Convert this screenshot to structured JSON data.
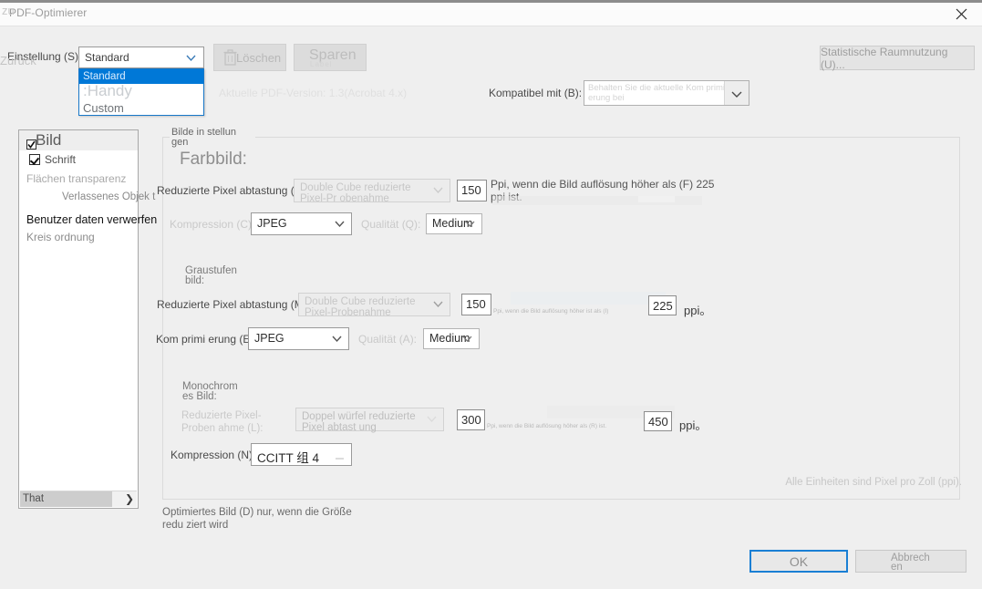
{
  "window": {
    "title": "PDF-Optimierer",
    "close_icon": "close-icon"
  },
  "toolbar": {
    "setting_label": "Einstellung (S):",
    "setting_value": "Standard",
    "setting_options": [
      "Standard",
      ":Handy",
      "Custom"
    ],
    "delete_label": "Löschen",
    "delete_icon": "trash-icon",
    "save_label": "Sparen",
    "save_sub_label": "Label",
    "stats_label": "Statistische Raumnutzung (U)...",
    "pdf_version": "Aktuelle PDF-Version: 1.3(Acrobat 4.x)",
    "compat_label": "Kompatibel mit (B):",
    "compat_value": "Behalten Sie die aktuelle Kom primi erung bei"
  },
  "sidebar": {
    "ghost_top": "zu",
    "ghost_mid": "Zurück",
    "items": [
      {
        "label": "Bild",
        "checkbox": true,
        "state": "selected"
      },
      {
        "label": "Schrift",
        "checkbox": true,
        "state": "checked"
      },
      {
        "label": "Flächen transparenz",
        "checkbox": false,
        "state": "normal"
      },
      {
        "label": "Verlassenes Objek t",
        "checkbox": false,
        "state": "normal"
      },
      {
        "label": "Benutzer daten verwerfen",
        "checkbox": false,
        "state": "bold"
      },
      {
        "label": "Kreis ordnung",
        "checkbox": false,
        "state": "normal"
      }
    ],
    "scroll_label": "That",
    "scroll_arrow": "chevron-right-icon"
  },
  "main": {
    "group_title": "Bilde in stellun gen",
    "color_image": {
      "section_title": "Farbbild:",
      "downsample_label": "Reduzierte Pixel abtastung (P):",
      "downsample_value": "Double Cube reduzierte Pixel-Pr obenahme",
      "ppi_value": "150",
      "ppi_note": "Ppi, wenn die Bild auflösung höher als (F) 225 ppi ist.",
      "compression_label": "Kompression (C):",
      "compression_value": "JPEG",
      "quality_label": "Qualität (Q):",
      "quality_value": "Medium"
    },
    "gray_image": {
      "section_title": "Graustufen bild:",
      "downsample_label": "Reduzierte Pixel abtastung (M):",
      "downsample_value": "Double Cube reduzierte Pixel-Probenahme",
      "ppi_value": "150",
      "ppi_note": "Ppi, wenn die Bild auflösung höher ist als (I)",
      "threshold_value": "225",
      "threshold_unit": "ppi。",
      "compression_label": "Kom primi erung (E):",
      "compression_value": "JPEG",
      "quality_label": "Qualität (A):",
      "quality_value": "Medium"
    },
    "mono_image": {
      "section_title": "Monochrom es Bild:",
      "downsample_label": "Reduzierte Pixel-Proben ahme (L):",
      "downsample_value": "Doppel würfel reduzierte Pixel abtast ung",
      "ppi_value": "300",
      "ppi_note": "Ppi, wenn die Bild auflösung höher als (R) ist.",
      "threshold_value": "450",
      "threshold_unit": "ppi。",
      "compression_label": "Kompression (N):",
      "compression_value": "CCITT 组 4"
    },
    "units_note": "Alle Einheiten sind Pixel pro Zoll (ppi).",
    "optimize_note": "Optimiertes Bild (D) nur, wenn die Größe redu ziert wird"
  },
  "footer": {
    "ok_label": "OK",
    "cancel_label_line1": "Abbrech",
    "cancel_label_line2": "en"
  },
  "colors": {
    "accent": "#0078d7",
    "focus_border": "#1a7fd4",
    "window_bg": "#efefef"
  }
}
